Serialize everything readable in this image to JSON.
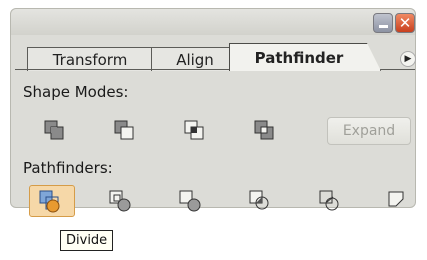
{
  "tabs": [
    {
      "label": "Transform"
    },
    {
      "label": "Align"
    },
    {
      "label": "Pathfinder"
    }
  ],
  "window_controls": {
    "minimize_icon": "minimize-icon",
    "close_icon": "close-icon",
    "close_glyph": "✕"
  },
  "menu_arrow_glyph": "▶",
  "shape_modes": {
    "label": "Shape Modes:",
    "icons": [
      "add-to-shape-area-icon",
      "subtract-from-shape-area-icon",
      "intersect-shape-areas-icon",
      "exclude-overlapping-shape-areas-icon"
    ],
    "expand_label": "Expand"
  },
  "pathfinders": {
    "label": "Pathfinders:",
    "icons": [
      "divide-icon",
      "trim-icon",
      "merge-icon",
      "crop-icon",
      "outline-icon",
      "minus-back-icon"
    ]
  },
  "tooltip": {
    "text": "Divide"
  },
  "colors": {
    "panel": "#dcdcd7",
    "active_highlight": "#f6d8a8",
    "close_button": "#d4532c"
  }
}
